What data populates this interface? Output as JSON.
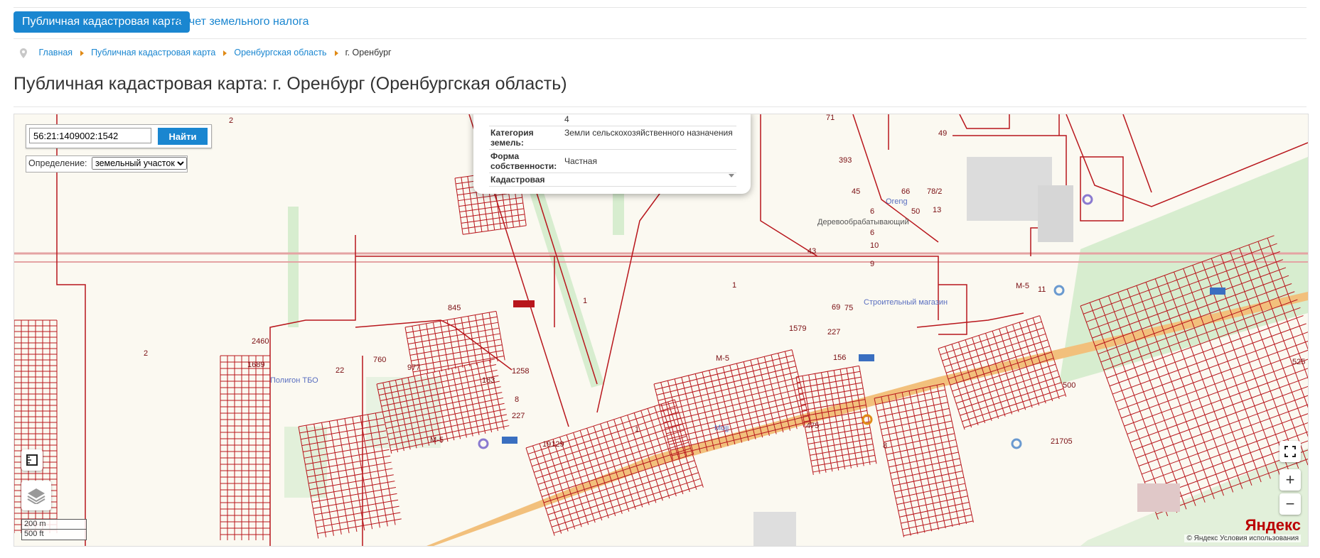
{
  "tabs": {
    "active": "Публичная кадастровая карта",
    "second": "Расчет земельного налога"
  },
  "breadcrumbs": {
    "home": "Главная",
    "map": "Публичная кадастровая карта",
    "region": "Оренбургская область",
    "current": "г. Оренбург"
  },
  "page_title": "Публичная кадастровая карта: г. Оренбург (Оренбургская область)",
  "search": {
    "value": "56:21:1409002:1542",
    "button": "Найти",
    "definition_label": "Определение:",
    "definition_value": "земельный участок"
  },
  "popup": {
    "top_value": "4",
    "rows": [
      {
        "key": "Категория земель:",
        "value": "Земли сельскохозяйственного назначения"
      },
      {
        "key": "Форма собственности:",
        "value": "Частная"
      },
      {
        "key": "Кадастровая",
        "value": ""
      }
    ]
  },
  "map": {
    "parcel_labels": [
      "2",
      "71",
      "49",
      "393",
      "45",
      "66",
      "78/2",
      "50",
      "6",
      "6",
      "13",
      "10",
      "9",
      "43",
      "1",
      "75",
      "69",
      "1579",
      "227",
      "1",
      "845",
      "2460",
      "760",
      "977",
      "1689",
      "22",
      "183",
      "1258",
      "8",
      "227",
      "2",
      "475",
      "19129",
      "500",
      "525",
      "21705",
      "8",
      "156",
      "1",
      "11",
      "M-5",
      "M-5",
      "M-5"
    ],
    "poi_labels": [
      "Деревообрабатывающий",
      "Строительный магазин",
      "Полигон ТБО",
      "Oreng",
      "Mojj"
    ],
    "scale_top": "200 m",
    "scale_bottom": "500 ft",
    "brand": "Яндекс",
    "copyright": "© Яндекс  Условия использования",
    "zoom_in": "+",
    "zoom_out": "−",
    "icons": [
      "ruler-icon",
      "layers-icon",
      "fullscreen-icon"
    ]
  },
  "colors": {
    "accent": "#1a86d0",
    "parcel_lines": "#b8161c",
    "green": "#d7edcf",
    "road": "#f2c07c",
    "map_bg": "#fbf9f1"
  }
}
